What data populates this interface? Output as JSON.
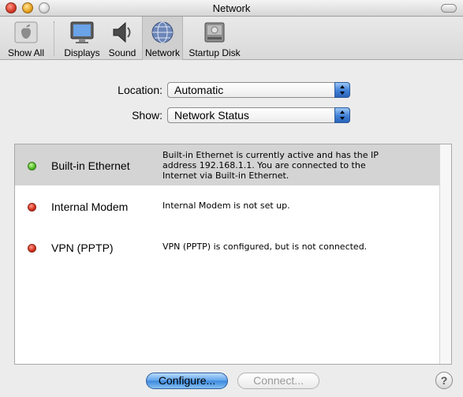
{
  "window": {
    "title": "Network"
  },
  "toolbar": {
    "items": [
      {
        "label": "Show All",
        "icon": "apple-show-all-icon"
      },
      {
        "label": "Displays",
        "icon": "display-monitor-icon"
      },
      {
        "label": "Sound",
        "icon": "speaker-icon"
      },
      {
        "label": "Network",
        "icon": "network-globe-icon",
        "selected": true
      },
      {
        "label": "Startup Disk",
        "icon": "hard-disk-icon"
      }
    ]
  },
  "location": {
    "label": "Location:",
    "value": "Automatic"
  },
  "show": {
    "label": "Show:",
    "value": "Network Status"
  },
  "status_list": {
    "rows": [
      {
        "name": "Built-in Ethernet",
        "status": "green",
        "description": "Built-in Ethernet is currently active and has the IP address 192.168.1.1. You are connected to the Internet via Built-in Ethernet."
      },
      {
        "name": "Internal Modem",
        "status": "red",
        "description": "Internal Modem is not set up."
      },
      {
        "name": "VPN (PPTP)",
        "status": "red",
        "description": "VPN (PPTP) is configured, but is not connected."
      }
    ]
  },
  "buttons": {
    "configure": "Configure...",
    "connect": "Connect...",
    "help": "?"
  },
  "colors": {
    "accent_blue": "#3b87dd",
    "status_green": "#49b81f",
    "status_red": "#d22a16",
    "selected_row": "#d4d4d4"
  }
}
